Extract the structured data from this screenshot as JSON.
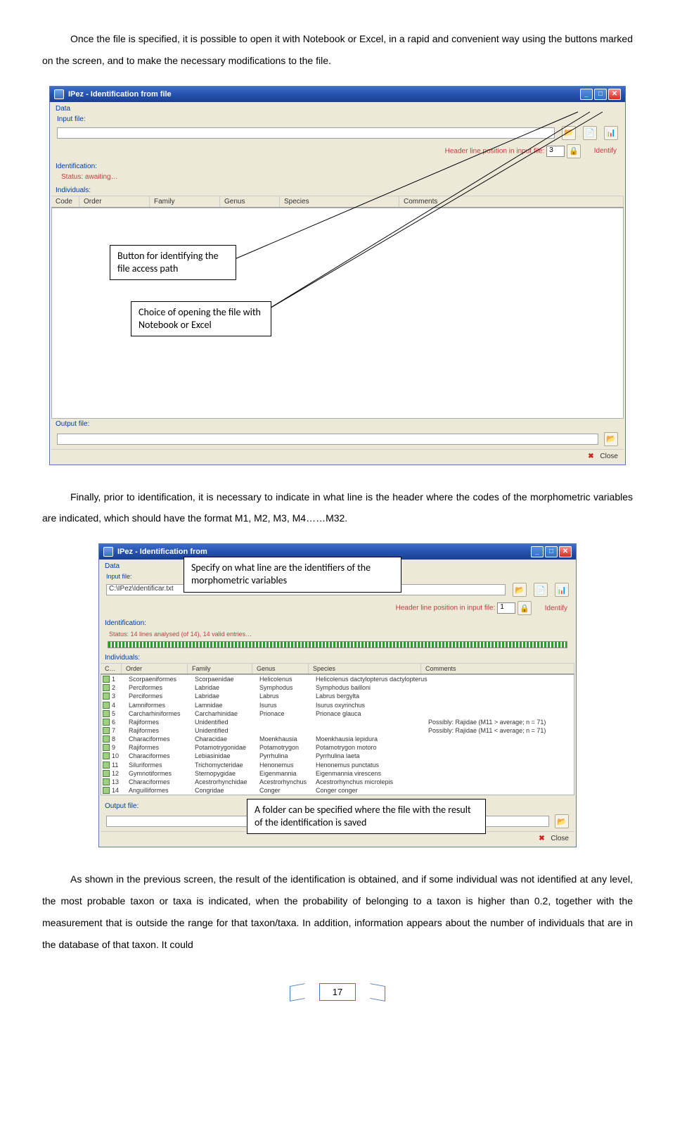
{
  "para1": "Once the file is specified, it is possible to open it with Notebook or Excel, in a rapid and convenient way using the buttons marked on the screen, and to make the necessary modifications to the file.",
  "para2": "Finally, prior to identification, it is necessary to indicate in what line is the header where the codes of the morphometric variables are indicated, which should have the format M1, M2, M3, M4……M32.",
  "para3": "As shown in the previous screen, the result of the identification is obtained, and if some individual was not identified at any level, the most probable taxon or taxa is indicated, when the probability of belonging to a taxon is higher than 0.2, together with the measurement that is outside the range for that taxon/taxa. In addition, information appears about the number of individuals that are in the database of that taxon. It could",
  "sc1": {
    "title": "IPez - Identification from file",
    "data_label": "Data",
    "input_file_label": "Input file:",
    "header_pos_label": "Header line position in input file:",
    "header_pos_value": "3",
    "identify": "Identify",
    "ident_label": "Identification:",
    "status": "Status: awaiting…",
    "indiv_label": "Individuals:",
    "cols": {
      "c": "Code",
      "o": "Order",
      "f": "Family",
      "g": "Genus",
      "s": "Species",
      "cm": "Comments"
    },
    "output_label": "Output file:",
    "close": "Close",
    "callout1": "Button for identifying the file access path",
    "callout2": "Choice of opening the file with Notebook or Excel"
  },
  "sc2": {
    "title": "IPez - Identification from",
    "data_label": "Data",
    "input_file_label": "Input file:",
    "input_file_value": "C:\\IPez\\Identificar.txt",
    "header_pos_label": "Header line position in input file:",
    "header_pos_value": "1",
    "identify": "Identify",
    "ident_label": "Identification:",
    "status": "Status: 14 lines analysed (of 14), 14 valid entries…",
    "indiv_label": "Individuals:",
    "cols": {
      "c": "C…",
      "o": "Order",
      "f": "Family",
      "g": "Genus",
      "s": "Species",
      "cm": "Comments"
    },
    "rows": [
      {
        "n": "1",
        "o": "Scorpaeniformes",
        "f": "Scorpaenidae",
        "g": "Helicolenus",
        "s": "Helicolenus dactylopterus dactylopterus",
        "c": ""
      },
      {
        "n": "2",
        "o": "Perciformes",
        "f": "Labridae",
        "g": "Symphodus",
        "s": "Symphodus bailloni",
        "c": ""
      },
      {
        "n": "3",
        "o": "Perciformes",
        "f": "Labridae",
        "g": "Labrus",
        "s": "Labrus bergylta",
        "c": ""
      },
      {
        "n": "4",
        "o": "Lamniformes",
        "f": "Lamnidae",
        "g": "Isurus",
        "s": "Isurus oxyrinchus",
        "c": ""
      },
      {
        "n": "5",
        "o": "Carcharhiniformes",
        "f": "Carcharhinidae",
        "g": "Prionace",
        "s": "Prionace glauca",
        "c": ""
      },
      {
        "n": "6",
        "o": "Rajiformes",
        "f": "Unidentified",
        "g": "",
        "s": "",
        "c": "Possibly: Rajidae (M11 > average; n = 71)"
      },
      {
        "n": "7",
        "o": "Rajiformes",
        "f": "Unidentified",
        "g": "",
        "s": "",
        "c": "Possibly: Rajidae (M11 < average; n = 71)"
      },
      {
        "n": "8",
        "o": "Characiformes",
        "f": "Characidae",
        "g": "Moenkhausia",
        "s": "Moenkhausia lepidura",
        "c": ""
      },
      {
        "n": "9",
        "o": "Rajiformes",
        "f": "Potamotrygonidae",
        "g": "Potamotrygon",
        "s": "Potamotrygon motoro",
        "c": ""
      },
      {
        "n": "10",
        "o": "Characiformes",
        "f": "Lebiasinidae",
        "g": "Pyrrhulina",
        "s": "Pyrrhulina laeta",
        "c": ""
      },
      {
        "n": "11",
        "o": "Siluriformes",
        "f": "Trichomycteridae",
        "g": "Henonemus",
        "s": "Henonemus punctatus",
        "c": ""
      },
      {
        "n": "12",
        "o": "Gymnotiformes",
        "f": "Sternopygidae",
        "g": "Eigenmannia",
        "s": "Eigenmannia virescens",
        "c": ""
      },
      {
        "n": "13",
        "o": "Characiformes",
        "f": "Acestrorhynchidae",
        "g": "Acestrorhynchus",
        "s": "Acestrorhynchus microlepis",
        "c": ""
      },
      {
        "n": "14",
        "o": "Anguilliformes",
        "f": "Congridae",
        "g": "Conger",
        "s": "Conger conger",
        "c": ""
      }
    ],
    "output_label": "Output file:",
    "close": "Close",
    "callout1": "Specify on what line are the identifiers of the morphometric variables",
    "callout2": "A folder can be specified where the file with the result of the identification is saved"
  },
  "page_number": "17"
}
